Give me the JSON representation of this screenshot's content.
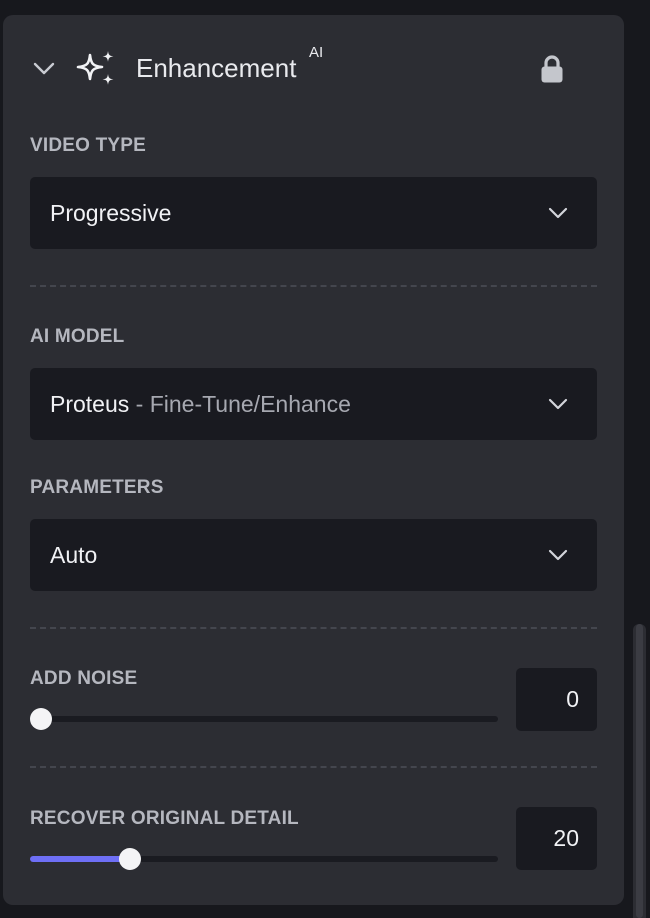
{
  "header": {
    "title": "Enhancement",
    "badge": "AI",
    "collapse_icon": "chevron-down-icon",
    "feature_icon": "sparkles-icon",
    "lock_icon": "lock-icon"
  },
  "video_type": {
    "label": "VIDEO TYPE",
    "value": "Progressive"
  },
  "ai_model": {
    "label": "AI MODEL",
    "model_name": "Proteus",
    "model_description": " - Fine-Tune/Enhance"
  },
  "parameters": {
    "label": "PARAMETERS",
    "value": "Auto"
  },
  "add_noise": {
    "label": "ADD NOISE",
    "value": "0",
    "fraction": 0.0
  },
  "recover_detail": {
    "label": "RECOVER ORIGINAL DETAIL",
    "value": "20",
    "fraction": 0.2
  },
  "colors": {
    "accent": "#6e6ff6",
    "panel": "#2c2d33",
    "field": "#191a20"
  }
}
